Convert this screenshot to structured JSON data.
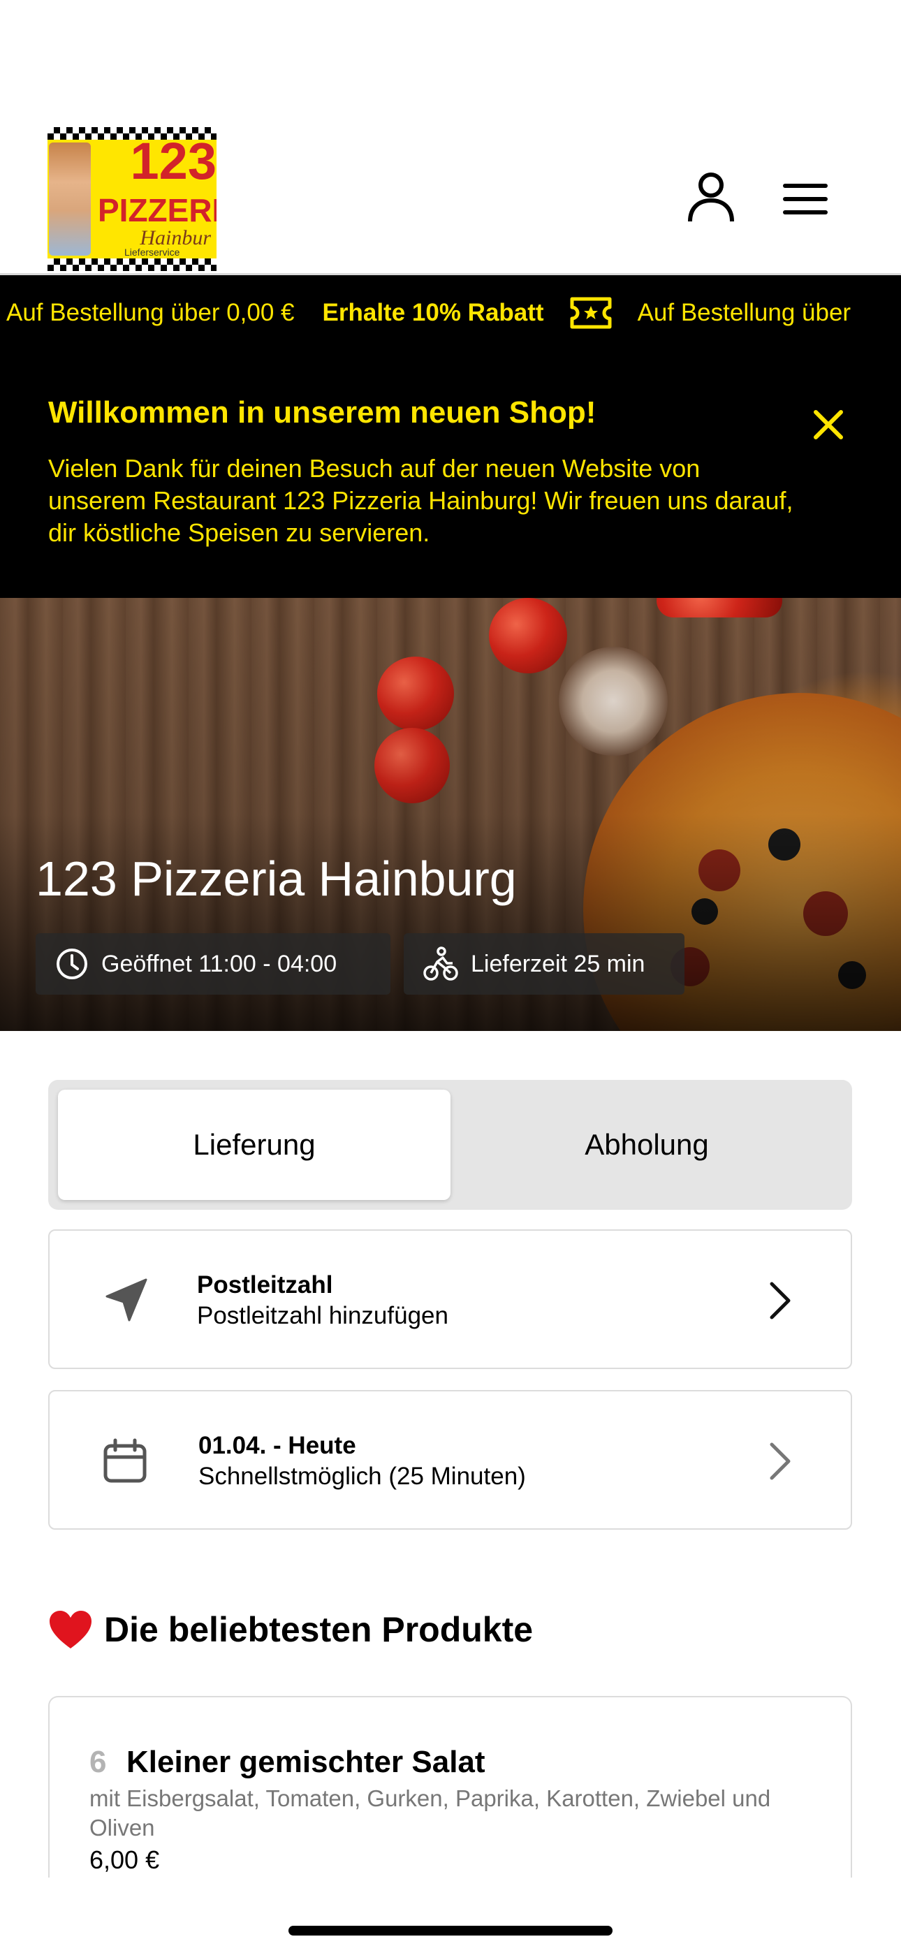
{
  "header": {
    "logo": {
      "number": "123",
      "brand": "PIZZERI",
      "script": "Hainbur",
      "tagline": "Lieferservice"
    },
    "icons": [
      "user-icon",
      "menu-icon"
    ]
  },
  "ticker": {
    "items": [
      {
        "text": "Auf Bestellung über 0,00 €",
        "bold": false
      },
      {
        "text": "Erhalte 10% Rabatt",
        "bold": true
      },
      {
        "text": "Auf Bestellung über",
        "bold": false
      }
    ],
    "icon": "ticket-star-icon",
    "color": "#ffe500"
  },
  "welcome": {
    "title": "Willkommen in unserem neuen Shop!",
    "text": "Vielen Dank für deinen Besuch auf der neuen Website von unserem Restaurant 123 Pizzeria Hainburg! Wir freuen uns darauf, dir köstliche Speisen zu servieren.",
    "close_icon": "close-icon"
  },
  "hero": {
    "title": "123 Pizzeria Hainburg",
    "opening": "Geöffnet 11:00 - 04:00",
    "delivery_time": "Lieferzeit 25 min"
  },
  "order_mode": {
    "tabs": [
      {
        "label": "Lieferung",
        "active": true
      },
      {
        "label": "Abholung",
        "active": false
      }
    ]
  },
  "postcode": {
    "title": "Postleitzahl",
    "subtitle": "Postleitzahl hinzufügen"
  },
  "schedule": {
    "title": "01.04. - Heute",
    "subtitle": "Schnellstmöglich (25 Minuten)"
  },
  "popular": {
    "emoji": "❤️",
    "title": "Die beliebtesten Produkte",
    "products": [
      {
        "number": "6",
        "name": "Kleiner gemischter Salat",
        "description": "mit Eisbergsalat, Tomaten, Gurken, Paprika, Karotten, Zwiebel und Oliven",
        "price": "6,00 €"
      }
    ]
  }
}
